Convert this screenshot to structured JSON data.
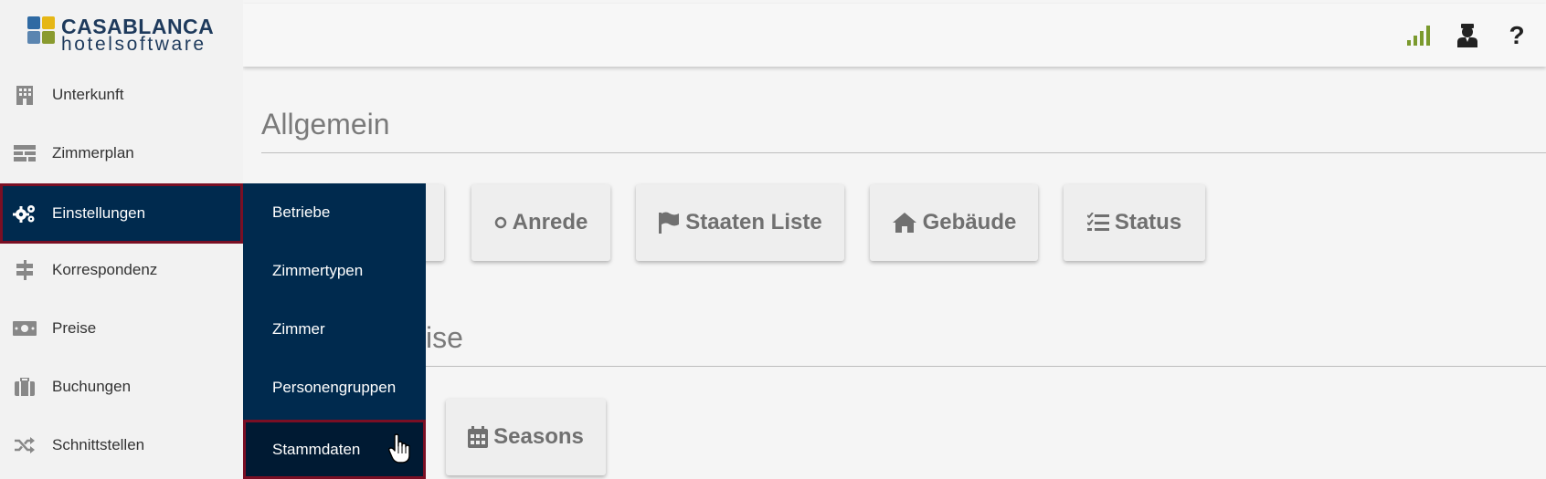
{
  "brand": {
    "line1": "CASABLANCA",
    "line2": "hotelsoftware"
  },
  "sidebar": {
    "items": [
      {
        "label": "Unterkunft",
        "icon": "building-icon"
      },
      {
        "label": "Zimmerplan",
        "icon": "room-plan-icon"
      },
      {
        "label": "Einstellungen",
        "icon": "gears-icon",
        "active": true
      },
      {
        "label": "Korrespondenz",
        "icon": "signpost-icon"
      },
      {
        "label": "Preise",
        "icon": "money-icon"
      },
      {
        "label": "Buchungen",
        "icon": "suitcase-icon"
      },
      {
        "label": "Schnittstellen",
        "icon": "shuffle-icon"
      }
    ]
  },
  "submenu": {
    "items": [
      {
        "label": "Betriebe"
      },
      {
        "label": "Zimmertypen"
      },
      {
        "label": "Zimmer"
      },
      {
        "label": "Personengruppen"
      },
      {
        "label": "Stammdaten",
        "active": true
      }
    ]
  },
  "topbar": {
    "icons": [
      "signal-icon",
      "user-tie-icon",
      "help-icon"
    ],
    "help_label": "?"
  },
  "main": {
    "sections": [
      {
        "title": "Allgemein",
        "cards": [
          {
            "label": ""
          },
          {
            "label": "Anrede",
            "icon": "circle-icon"
          },
          {
            "label": "Staaten Liste",
            "icon": "flag-icon"
          },
          {
            "label": "Gebäude",
            "icon": "home-icon"
          },
          {
            "label": "Status",
            "icon": "tasks-icon"
          }
        ]
      },
      {
        "title": "ise",
        "cards": [
          {
            "label": "Seasons",
            "icon": "calendar-icon"
          }
        ]
      }
    ]
  },
  "colors": {
    "sidebar_active": "#002a4e",
    "highlight_border": "#7a0f24",
    "signal": "#7b9a2e",
    "card_text": "#707070"
  }
}
